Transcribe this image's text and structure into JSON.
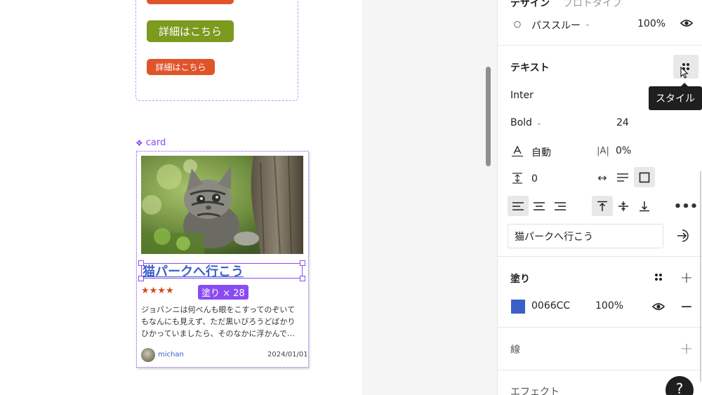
{
  "canvas": {
    "button_top_label": "",
    "button_green_label": "詳細はこちら",
    "button_small_label": "詳細はこちら",
    "card_label": "card",
    "card": {
      "title": "猫パークへ行こう",
      "stars": "★★★★",
      "fill_badge": "塗り × 28",
      "body_lines": [
        "ジョバンニは何べんも眼をこすってのぞいて",
        "もなんにも見えず、ただ黒いびろうどばかり",
        "ひかっていましたら、そのなかに浮かんで…"
      ],
      "author": "michan",
      "date": "2024/01/01"
    }
  },
  "panel": {
    "tabs": {
      "design": "デザイン",
      "prototype": "プロトタイプ"
    },
    "layer": {
      "blend_mode": "パススルー",
      "opacity": "100%"
    },
    "text_section": {
      "title": "テキスト",
      "font_family": "Inter",
      "font_weight": "Bold",
      "font_size": "24",
      "line_height": "自動",
      "letter_spacing": "0%",
      "paragraph_spacing": "0",
      "content": "猫パークへ行こう"
    },
    "tooltip": "スタイル",
    "fill_section": {
      "title": "塗り",
      "hex": "0066CC",
      "opacity": "100%",
      "swatch_color": "#3b5fc9"
    },
    "stroke_section": {
      "title": "線"
    },
    "effect_section": {
      "title": "エフェクト"
    },
    "help": "?"
  }
}
